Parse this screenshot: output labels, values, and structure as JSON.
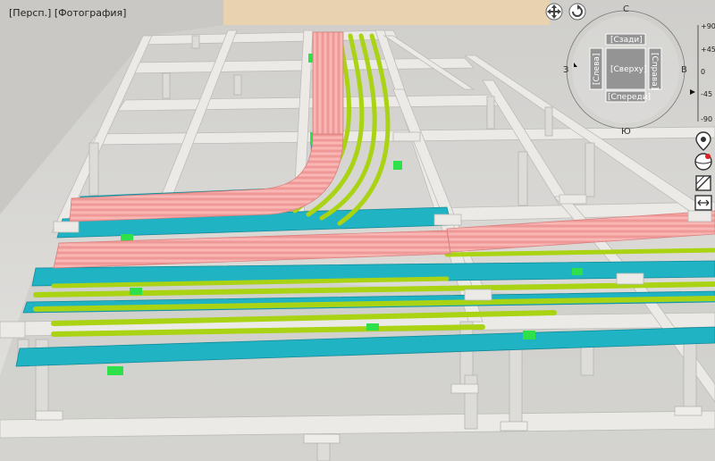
{
  "viewport": {
    "mode_label": "[Персп.]",
    "style_label": "[Фотография]"
  },
  "view_cube": {
    "compass": {
      "north": "С",
      "south": "Ю",
      "east": "В",
      "west": "З"
    },
    "faces": {
      "top": "[Сверху]",
      "back": "[Сзади]",
      "front": "[Спереди]",
      "left": "[Слева]",
      "right": "[Справа]"
    },
    "scale_labels": [
      "+90",
      "+45",
      "0",
      "-45",
      "-90"
    ]
  },
  "colors": {
    "floor": "#d4d3cf",
    "beam": "#e9e8e5",
    "column": "#dcdbd7",
    "tray_cyan": "#20b8c8",
    "cable_pink": "#f4a7a5",
    "pipe_lime": "#b9e21e",
    "bracket_green": "#2ee04a",
    "wall_beige": "#e8d2b0"
  },
  "icons": [
    "pan-icon",
    "orbit-icon",
    "location-pin-icon",
    "look-around-icon",
    "section-box-icon",
    "walk-icon"
  ]
}
